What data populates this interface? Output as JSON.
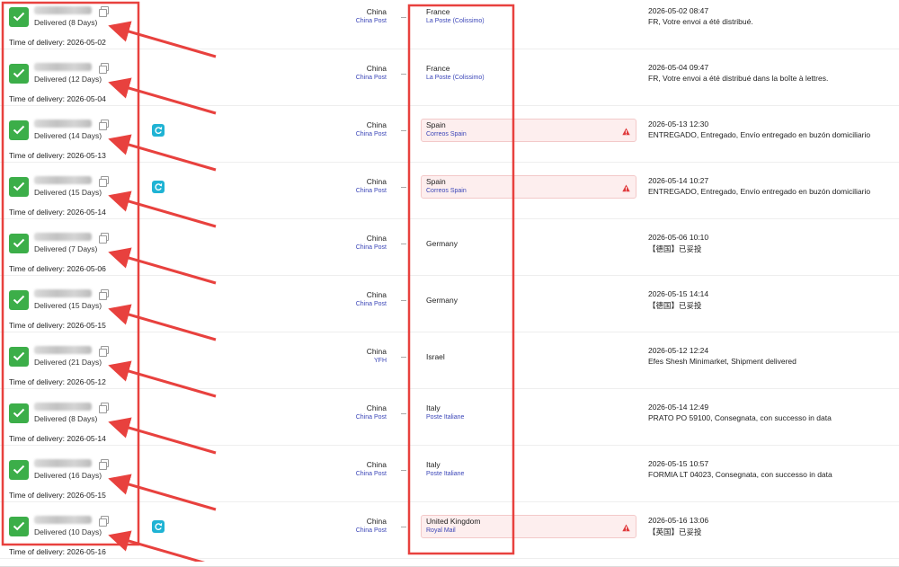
{
  "colors": {
    "delivered_green": "#3cae49",
    "carrier_link": "#3b46b8",
    "refresh_cyan": "#1fb3d4",
    "warning_bg": "#fdeeee",
    "annotation_red": "#e8413e"
  },
  "rows": [
    {
      "status": "Delivered (8 Days)",
      "delivery": "Time of delivery: 2026-05-02",
      "refresh": false,
      "origin": "China",
      "origin_carrier": "China Post",
      "destination": "France",
      "destination_carrier": "La Poste (Colissimo)",
      "warning": false,
      "event_time": "2026-05-02 08:47",
      "event_desc": "FR, Votre envoi a été distribué."
    },
    {
      "status": "Delivered (12 Days)",
      "delivery": "Time of delivery: 2026-05-04",
      "refresh": false,
      "origin": "China",
      "origin_carrier": "China Post",
      "destination": "France",
      "destination_carrier": "La Poste (Colissimo)",
      "warning": false,
      "event_time": "2026-05-04 09:47",
      "event_desc": "FR, Votre envoi a été distribué dans la boîte à lettres."
    },
    {
      "status": "Delivered (14 Days)",
      "delivery": "Time of delivery: 2026-05-13",
      "refresh": true,
      "origin": "China",
      "origin_carrier": "China Post",
      "destination": "Spain",
      "destination_carrier": "Correos Spain",
      "warning": true,
      "event_time": "2026-05-13 12:30",
      "event_desc": "ENTREGADO, Entregado, Envío entregado en buzón domiciliario"
    },
    {
      "status": "Delivered (15 Days)",
      "delivery": "Time of delivery: 2026-05-14",
      "refresh": true,
      "origin": "China",
      "origin_carrier": "China Post",
      "destination": "Spain",
      "destination_carrier": "Correos Spain",
      "warning": true,
      "event_time": "2026-05-14 10:27",
      "event_desc": "ENTREGADO, Entregado, Envío entregado en buzón domiciliario"
    },
    {
      "status": "Delivered (7 Days)",
      "delivery": "Time of delivery: 2026-05-06",
      "refresh": false,
      "origin": "China",
      "origin_carrier": "China Post",
      "destination": "Germany",
      "destination_carrier": "",
      "warning": false,
      "event_time": "2026-05-06 10:10",
      "event_desc": "【德国】已妥投"
    },
    {
      "status": "Delivered (15 Days)",
      "delivery": "Time of delivery: 2026-05-15",
      "refresh": false,
      "origin": "China",
      "origin_carrier": "China Post",
      "destination": "Germany",
      "destination_carrier": "",
      "warning": false,
      "event_time": "2026-05-15 14:14",
      "event_desc": "【德国】已妥投"
    },
    {
      "status": "Delivered (21 Days)",
      "delivery": "Time of delivery: 2026-05-12",
      "refresh": false,
      "origin": "China",
      "origin_carrier": "YFH",
      "destination": "Israel",
      "destination_carrier": "",
      "warning": false,
      "event_time": "2026-05-12 12:24",
      "event_desc": "Efes Shesh Minimarket, Shipment delivered"
    },
    {
      "status": "Delivered (8 Days)",
      "delivery": "Time of delivery: 2026-05-14",
      "refresh": false,
      "origin": "China",
      "origin_carrier": "China Post",
      "destination": "Italy",
      "destination_carrier": "Poste Italiane",
      "warning": false,
      "event_time": "2026-05-14 12:49",
      "event_desc": "PRATO PO 59100, Consegnata, con successo in data"
    },
    {
      "status": "Delivered (16 Days)",
      "delivery": "Time of delivery: 2026-05-15",
      "refresh": false,
      "origin": "China",
      "origin_carrier": "China Post",
      "destination": "Italy",
      "destination_carrier": "Poste Italiane",
      "warning": false,
      "event_time": "2026-05-15 10:57",
      "event_desc": "FORMIA LT 04023, Consegnata, con successo in data"
    },
    {
      "status": "Delivered (10 Days)",
      "delivery": "Time of delivery: 2026-05-16",
      "refresh": true,
      "origin": "China",
      "origin_carrier": "China Post",
      "destination": "United Kingdom",
      "destination_carrier": "Royal Mail",
      "warning": true,
      "event_time": "2026-05-16 13:06",
      "event_desc": "【英国】已妥投"
    }
  ]
}
